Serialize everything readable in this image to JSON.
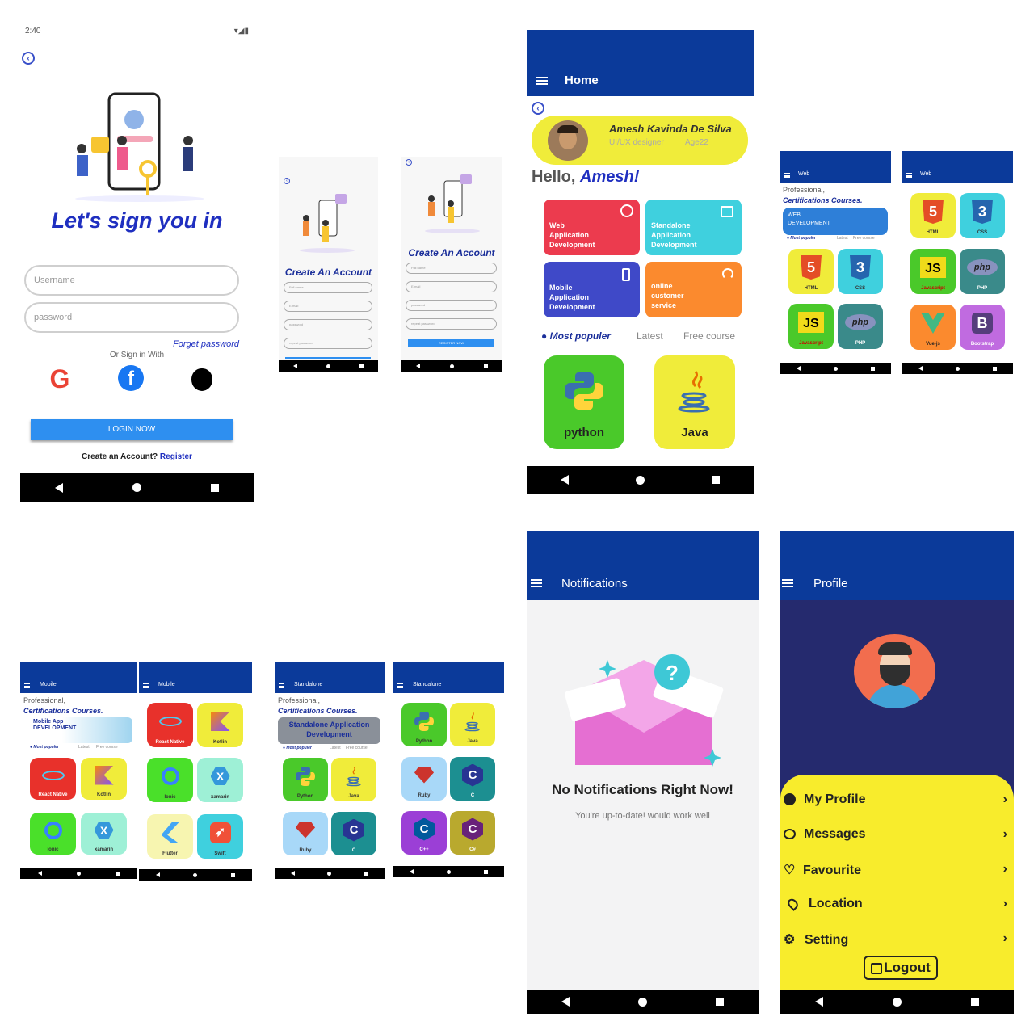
{
  "login": {
    "time": "2:40",
    "title": "Let's sign you in",
    "username_placeholder": "Username",
    "password_placeholder": "password",
    "forget": "Forget password",
    "or_sign": "Or Sign in With",
    "login_btn": "LOGIN NOW",
    "create_text": "Create an Account?",
    "register": "Register"
  },
  "create1": {
    "title": "Create An Account",
    "fields": [
      "Full name",
      "E-mail",
      "password",
      "repeat password"
    ]
  },
  "create2": {
    "title": "Create An Account",
    "fields": [
      "Full name",
      "E-mail",
      "password",
      "repeat password"
    ],
    "btn": "REGISTER NOW"
  },
  "home": {
    "bar_title": "Home",
    "name": "Amesh Kavinda De Silva",
    "role": "UI/UX designer",
    "age": "Age22",
    "hello": "Hello,",
    "hello_name": "Amesh!",
    "cats": [
      {
        "label": "Web Application Development",
        "color": "#ec3b4e"
      },
      {
        "label": "Standalone Application Development",
        "color": "#3fd0de"
      },
      {
        "label": "Mobile Application Development",
        "color": "#3f49c8"
      },
      {
        "label": "online customer service",
        "color": "#fb8a2e"
      }
    ],
    "tabs": [
      "Most populer",
      "Latest",
      "Free course"
    ],
    "courses": [
      "python",
      "Java"
    ]
  },
  "web1": {
    "bar_title": "Web",
    "prof": "Professional,",
    "cert": "Certifications Courses.",
    "banner": "WEB DEVELOPMENT",
    "tabs": [
      "Most populer",
      "Latest",
      "Free course"
    ],
    "tiles": [
      "HTML",
      "CSS",
      "Javascript",
      "PHP"
    ]
  },
  "web2": {
    "bar_title": "Web",
    "tiles": [
      "HTML",
      "CSS",
      "Javascript",
      "PHP",
      "Vue-js",
      "Bootstrap"
    ]
  },
  "mob1": {
    "bar_title": "Mobile",
    "prof": "Professional,",
    "cert": "Certifications Courses.",
    "banner": "Mobile App DEVELOPMENT",
    "tabs": [
      "Most populer",
      "Latest",
      "Free course"
    ],
    "tiles": [
      "React Native",
      "Kotlin",
      "Ionic",
      "xamarin"
    ]
  },
  "mob2": {
    "bar_title": "Mobile",
    "tiles": [
      "React Native",
      "Kotlin",
      "Ionic",
      "xamarin",
      "Flutter",
      "Swift"
    ]
  },
  "sa1": {
    "bar_title": "Standalone",
    "prof": "Professional,",
    "cert": "Certifications Courses.",
    "banner": "Standalone Application Development",
    "tabs": [
      "Most populer",
      "Latest",
      "Free course"
    ],
    "tiles": [
      "Python",
      "Java",
      "Ruby",
      "C"
    ]
  },
  "sa2": {
    "bar_title": "Standalone",
    "tiles": [
      "Python",
      "Java",
      "Ruby",
      "C",
      "C++",
      "C#"
    ]
  },
  "notif": {
    "bar_title": "Notifications",
    "heading": "No Notifications Right Now!",
    "sub": "You're up-to-date! would work well"
  },
  "profile": {
    "bar_title": "Profile",
    "items": [
      "My Profile",
      "Messages",
      "Favourite",
      "Location",
      "Setting"
    ],
    "logout": "Logout"
  }
}
